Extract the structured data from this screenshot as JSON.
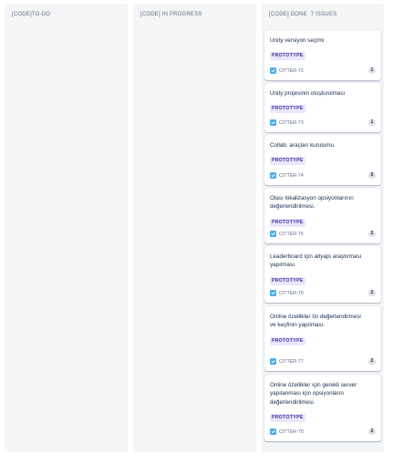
{
  "columns": [
    {
      "name": "[CODE]TO-DO",
      "count": ""
    },
    {
      "name": "[CODE] IN PROGRESS",
      "count": ""
    },
    {
      "name": "[CODE] DONE",
      "count": "7 ISSUES"
    }
  ],
  "done_cards": [
    {
      "title": "Unity versiyon seçimi",
      "tag": "PROTOTYPE",
      "key": "CITTER-72",
      "estimate": "1"
    },
    {
      "title": "Unity projesinin oluşturulması",
      "tag": "PROTOTYPE",
      "key": "CITTER-73",
      "estimate": "1"
    },
    {
      "title": "Collab. araçları kurulumu.",
      "tag": "PROTOTYPE",
      "key": "CITTER-74",
      "estimate": "5"
    },
    {
      "title": "Olası lokalizasyon opsiyonlarının değerlendirilmesi.",
      "tag": "PROTOTYPE",
      "key": "CITTER-75",
      "estimate": "2"
    },
    {
      "title": "Leaderboard için altyapı araştırması yapılması.",
      "tag": "PROTOTYPE",
      "key": "CITTER-76",
      "estimate": "2"
    },
    {
      "title": "Online özellikler ön değerlendirmesi ve keşfinin yapılması.",
      "tag": "PROTOTYPE",
      "key": "CITTER-77",
      "estimate": "2"
    },
    {
      "title": "Online özellikler için gerekli server yapılanması için opsiyonların değerlendirilmesi.",
      "tag": "PROTOTYPE",
      "key": "CITTER-78",
      "estimate": "2"
    }
  ],
  "colors": {
    "column_bg": "#f4f5f7",
    "tag_bg": "#eae6ff",
    "tag_text": "#403294",
    "task_icon": "#4bade8"
  },
  "icons": {
    "issue_type": "task-checkbox-icon"
  }
}
